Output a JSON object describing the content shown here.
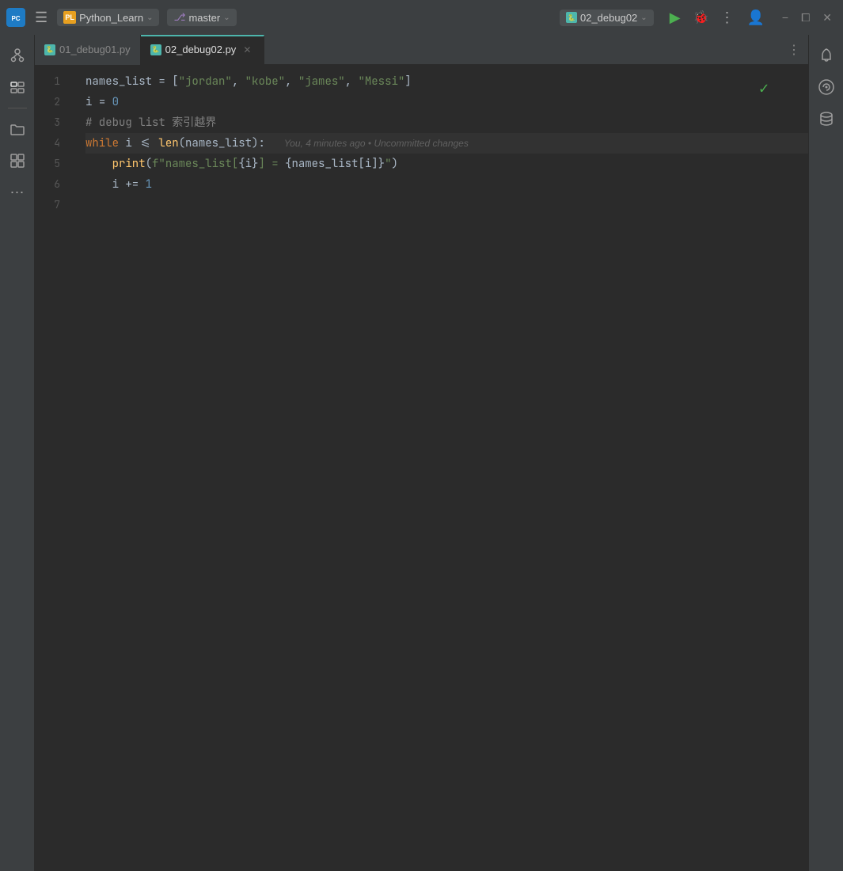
{
  "titlebar": {
    "logo_text": "PC",
    "hamburger": "☰",
    "project_icon": "PL",
    "project_name": "Python_Learn",
    "chevron": "∨",
    "branch_icon": "⎇",
    "branch_name": "master",
    "file_name": "02_debug02",
    "run_icon": "▶",
    "debug_icon": "🐞",
    "more_icon": "⋮",
    "user_icon": "👤",
    "minimize": "−",
    "maximize": "⧠",
    "close": "✕"
  },
  "tabs": [
    {
      "label": "01_debug01.py",
      "active": false
    },
    {
      "label": "02_debug02.py",
      "active": true
    }
  ],
  "editor": {
    "lines": [
      {
        "number": "1",
        "content": "names_list = [\"jordan\", \"kobe\", \"james\", \"Messi\"]"
      },
      {
        "number": "2",
        "content": "i = 0"
      },
      {
        "number": "3",
        "content": "# debug list 索引越界"
      },
      {
        "number": "4",
        "content": "while i <= len(names_list):    You, 4 minutes ago • Uncommitted changes",
        "has_annotation": true,
        "annotation": "You, 4 minutes ago • Uncommitted changes"
      },
      {
        "number": "5",
        "content": "    print(f\"names_list[{i}] = {names_list[i]}\")"
      },
      {
        "number": "6",
        "content": "    i += 1"
      },
      {
        "number": "7",
        "content": ""
      }
    ]
  },
  "activity_bar": {
    "icons": [
      "⊙",
      "∿",
      "—",
      "📁",
      "⊞",
      "⋯"
    ]
  },
  "right_sidebar": {
    "icons": [
      "🔔",
      "✦",
      "🗄"
    ]
  }
}
